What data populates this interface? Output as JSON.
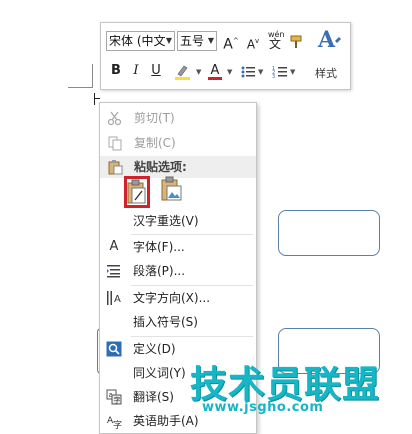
{
  "mini_toolbar": {
    "font_name": "宋体 (中文",
    "font_size": "五号",
    "grow_font": "A",
    "shrink_font": "A",
    "phonetic": "wén",
    "bold": "B",
    "italic": "I",
    "underline": "U",
    "font_color": "A",
    "styles_label": "样式",
    "highlight_color": "#f4e23a",
    "font_color_value": "#d0222a"
  },
  "context_menu": {
    "cut": "剪切(T)",
    "copy": "复制(C)",
    "paste_options_header": "粘贴选项:",
    "hanzi_reselect": "汉字重选(V)",
    "font": "字体(F)...",
    "paragraph": "段落(P)...",
    "text_direction": "文字方向(X)...",
    "insert_symbol": "插入符号(S)",
    "define": "定义(D)",
    "synonyms": "同义词(Y)",
    "translate": "翻译(S)",
    "english_assistant": "英语助手(A)"
  },
  "watermark": {
    "title": "技术员联盟",
    "url": "www.jsgho.com",
    "color": "#16b6c6"
  }
}
